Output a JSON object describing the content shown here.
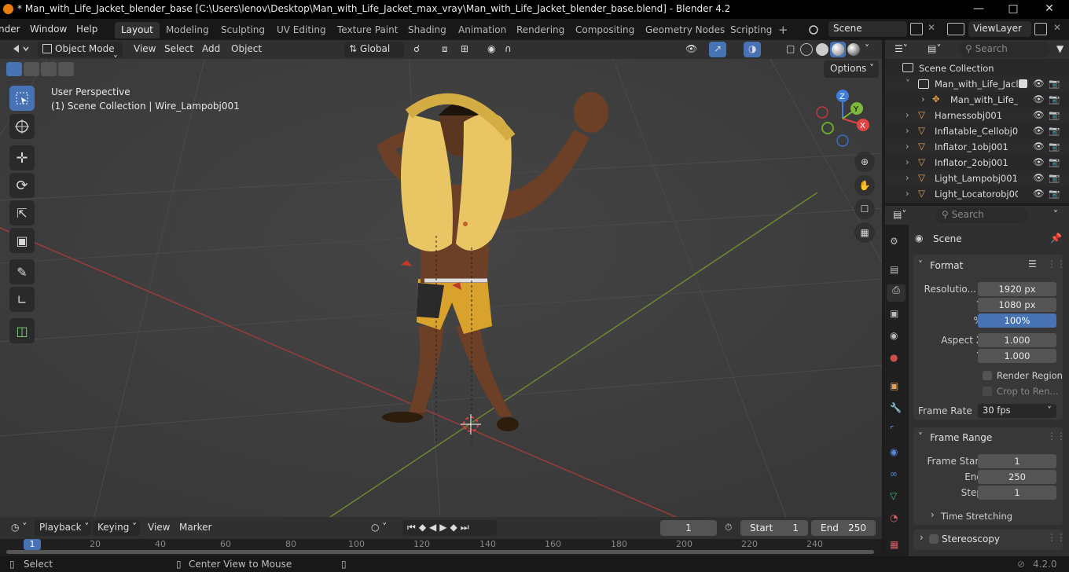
{
  "window": {
    "title": "* Man_with_Life_Jacket_blender_base [C:\\Users\\lenov\\Desktop\\Man_with_Life_Jacket_max_vray\\Man_with_Life_Jacket_blender_base.blend] - Blender 4.2"
  },
  "menubar": {
    "menus": [
      "nder",
      "Window",
      "Help"
    ],
    "workspaces": [
      "Layout",
      "Modeling",
      "Sculpting",
      "UV Editing",
      "Texture Paint",
      "Shading",
      "Animation",
      "Rendering",
      "Compositing",
      "Geometry Nodes",
      "Scripting"
    ],
    "active_workspace": "Layout",
    "scene": "Scene",
    "view_layer": "ViewLayer"
  },
  "viewport_header": {
    "mode": "Object Mode",
    "menus": [
      "View",
      "Select",
      "Add",
      "Object"
    ],
    "orientation": "Global"
  },
  "viewport": {
    "perspective_label": "User Perspective",
    "collection_label": "(1) Scene Collection | Wire_Lampobj001",
    "options_label": "Options",
    "gizmo": {
      "x": "X",
      "y": "Y",
      "z": "Z"
    }
  },
  "outliner": {
    "search_placeholder": "Search",
    "root": "Scene Collection",
    "items": [
      {
        "label": "Man_with_Life_Jacl",
        "type": "collection"
      },
      {
        "label": "Man_with_Life_",
        "type": "armature"
      },
      {
        "label": "Harnessobj001",
        "type": "mesh"
      },
      {
        "label": "Inflatable_Cellobj0",
        "type": "mesh"
      },
      {
        "label": "Inflator_1obj001",
        "type": "mesh"
      },
      {
        "label": "Inflator_2obj001",
        "type": "mesh"
      },
      {
        "label": "Light_Lampobj001",
        "type": "mesh"
      },
      {
        "label": "Light_Locatorobj0C",
        "type": "mesh"
      }
    ]
  },
  "properties": {
    "search_placeholder": "Search",
    "context": "Scene",
    "format": {
      "title": "Format",
      "resolution_label": "Resolutio...",
      "res_x": "1920 px",
      "y_label": "Y",
      "res_y": "1080 px",
      "pct_label": "%",
      "pct": "100%",
      "aspect_label": "Aspect X",
      "aspect_x": "1.000",
      "aspect_y": "1.000",
      "render_region": "Render Region",
      "crop": "Crop to Ren...",
      "frame_rate_label": "Frame Rate",
      "frame_rate": "30 fps"
    },
    "frame_range": {
      "title": "Frame Range",
      "start_label": "Frame Start",
      "start": "1",
      "end_label": "End",
      "end": "250",
      "step_label": "Step",
      "step": "1",
      "time_stretching": "Time Stretching"
    },
    "stereoscopy": "Stereoscopy"
  },
  "timeline": {
    "menus": [
      "Playback",
      "Keying",
      "View",
      "Marker"
    ],
    "current_frame": "1",
    "start_label": "Start",
    "start": "1",
    "end_label": "End",
    "end": "250",
    "ticks": [
      "1",
      "20",
      "40",
      "60",
      "80",
      "100",
      "120",
      "140",
      "160",
      "180",
      "200",
      "220",
      "240"
    ]
  },
  "statusbar": {
    "select": "Select",
    "center_view": "Center View to Mouse",
    "version": "4.2.0"
  }
}
